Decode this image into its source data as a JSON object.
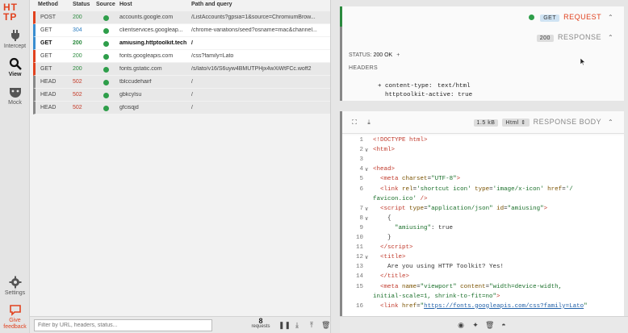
{
  "app": {
    "logo": [
      "HT",
      "TP"
    ]
  },
  "nav": [
    {
      "label": "Intercept",
      "icon": "plug-icon"
    },
    {
      "label": "View",
      "icon": "search-icon"
    },
    {
      "label": "Mock",
      "icon": "mock-icon"
    },
    {
      "label": "Settings",
      "icon": "gear-icon"
    },
    {
      "label": "Give feedback",
      "icon": "feedback-icon"
    }
  ],
  "table": {
    "columns": [
      "Method",
      "Status",
      "Source",
      "Host",
      "Path and query"
    ],
    "rows": [
      {
        "method": "POST",
        "status": "200",
        "host": "accounts.google.com",
        "path": "/ListAccounts?gpsia=1&source=ChromiumBrow..."
      },
      {
        "method": "GET",
        "status": "304",
        "host": "clientservices.googleap...",
        "path": "/chrome-variations/seed?osname=mac&channel..."
      },
      {
        "method": "GET",
        "status": "200",
        "host": "amiusing.httptoolkit.tech",
        "path": "/"
      },
      {
        "method": "GET",
        "status": "200",
        "host": "fonts.googleapis.com",
        "path": "/css?family=Lato"
      },
      {
        "method": "GET",
        "status": "200",
        "host": "fonts.gstatic.com",
        "path": "/s/lato/v16/S6uyw4BMUTPHjx4wXiWtFCc.woff2"
      },
      {
        "method": "HEAD",
        "status": "502",
        "host": "tblccudehairf",
        "path": "/"
      },
      {
        "method": "HEAD",
        "status": "502",
        "host": "gbkcylsu",
        "path": "/"
      },
      {
        "method": "HEAD",
        "status": "502",
        "host": "gfcisqjd",
        "path": "/"
      }
    ]
  },
  "footer": {
    "filter_placeholder": "Filter by URL, headers, status...",
    "count": "8",
    "count_label": "requests"
  },
  "request_card": {
    "method": "GET",
    "title": "REQUEST"
  },
  "response_card": {
    "status_code": "200",
    "title": "RESPONSE",
    "status_label": "STATUS:",
    "status_value": "200 OK",
    "headers_label": "HEADERS",
    "headers": [
      {
        "name": "content-type:",
        "value": "text/html"
      },
      {
        "name": "httptoolkit-active:",
        "value": "true"
      }
    ]
  },
  "body_card": {
    "size": "1.5 kB",
    "format": "Html",
    "title": "RESPONSE BODY",
    "lines": [
      {
        "n": "1",
        "fold": "",
        "html": "<span class='tag'>&lt;!DOCTYPE html&gt;</span>"
      },
      {
        "n": "2",
        "fold": "∨",
        "html": "<span class='tag'>&lt;html&gt;</span>"
      },
      {
        "n": "3",
        "fold": "",
        "html": ""
      },
      {
        "n": "4",
        "fold": "∨",
        "html": "<span class='tag'>&lt;head&gt;</span>"
      },
      {
        "n": "5",
        "fold": "",
        "html": "  <span class='tag'>&lt;meta</span> <span class='attr'>charset</span>=<span class='str'>\"UTF-8\"</span><span class='tag'>&gt;</span>"
      },
      {
        "n": "6",
        "fold": "",
        "html": "  <span class='tag'>&lt;link</span> <span class='attr'>rel</span>=<span class='str'>'shortcut icon'</span> <span class='attr'>type</span>=<span class='str'>'image/x-icon'</span> <span class='attr'>href</span>=<span class='str'>'/</span>"
      },
      {
        "n": "",
        "fold": "",
        "html": "<span class='str'>favicon.ico'</span> <span class='tag'>/&gt;</span>"
      },
      {
        "n": "7",
        "fold": "∨",
        "html": "  <span class='tag'>&lt;script</span> <span class='attr'>type</span>=<span class='str'>\"application/json\"</span> <span class='attr'>id</span>=<span class='str'>\"amiusing\"</span><span class='tag'>&gt;</span>"
      },
      {
        "n": "8",
        "fold": "∨",
        "html": "    {"
      },
      {
        "n": "9",
        "fold": "",
        "html": "      <span class='str'>\"amiusing\"</span>: true"
      },
      {
        "n": "10",
        "fold": "",
        "html": "    }"
      },
      {
        "n": "11",
        "fold": "",
        "html": "  <span class='tag'>&lt;/script&gt;</span>"
      },
      {
        "n": "12",
        "fold": "∨",
        "html": "  <span class='tag'>&lt;title&gt;</span>"
      },
      {
        "n": "13",
        "fold": "",
        "html": "    Are you using HTTP Toolkit? Yes!"
      },
      {
        "n": "14",
        "fold": "",
        "html": "  <span class='tag'>&lt;/title&gt;</span>"
      },
      {
        "n": "15",
        "fold": "",
        "html": "  <span class='tag'>&lt;meta</span> <span class='attr'>name</span>=<span class='str'>\"viewport\"</span> <span class='attr'>content</span>=<span class='str'>\"width=device-width,</span>"
      },
      {
        "n": "",
        "fold": "",
        "html": "<span class='str'>initial-scale=1, shrink-to-fit=no\"</span><span class='tag'>&gt;</span>"
      },
      {
        "n": "16",
        "fold": "",
        "html": "  <span class='tag'>&lt;link</span> <span class='attr'>href</span>=<span class='str'>\"</span><span class='url'>https://fonts.googleapis.com/css?family=Lato</span><span class='str'>\"</span>"
      }
    ]
  },
  "colors": {
    "accent": "#e1421f",
    "ok": "#2b8a3e",
    "not_modified": "#2f7fc1",
    "error": "#c53c2a"
  }
}
